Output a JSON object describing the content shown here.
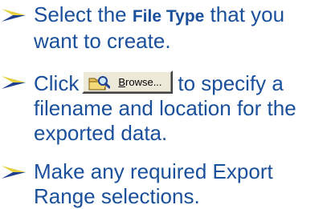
{
  "steps": [
    {
      "icon": "arrow-bullet-icon",
      "before": "Select the ",
      "bold": "File Type",
      "after": " that you want to create."
    },
    {
      "icon": "arrow-bullet-icon",
      "before": "Click",
      "button": {
        "icon": "browse-folder-icon",
        "label_underlined": "B",
        "label_rest": "rowse..."
      },
      "after": "to specify a filename and location for the exported data."
    },
    {
      "icon": "arrow-bullet-icon",
      "text": "Make any required Export Range selections."
    }
  ],
  "colors": {
    "text": "#1a4f9c",
    "arrow_light": "#e4d040",
    "arrow_dark": "#1d3f8e"
  }
}
